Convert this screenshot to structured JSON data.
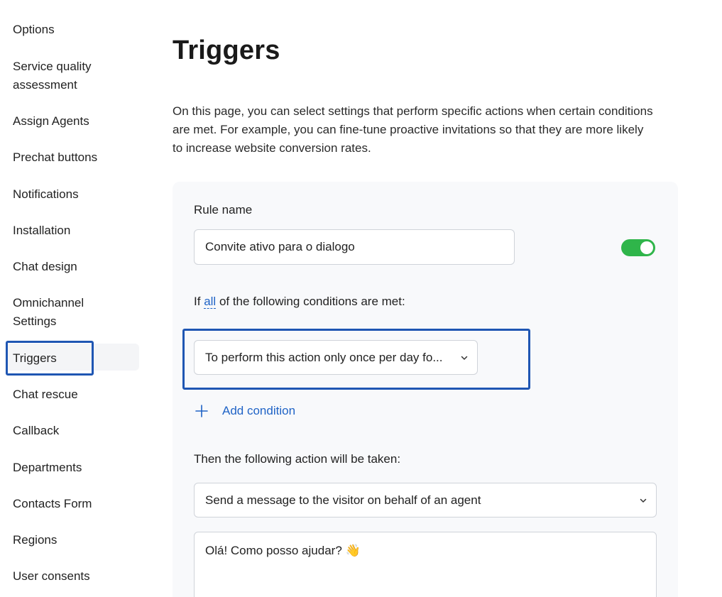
{
  "sidebar": {
    "items": [
      {
        "label": "Options"
      },
      {
        "label": "Service quality assessment"
      },
      {
        "label": "Assign Agents"
      },
      {
        "label": "Prechat buttons"
      },
      {
        "label": "Notifications"
      },
      {
        "label": "Installation"
      },
      {
        "label": "Chat design"
      },
      {
        "label": "Omnichannel Settings"
      },
      {
        "label": "Triggers"
      },
      {
        "label": "Chat rescue"
      },
      {
        "label": "Callback"
      },
      {
        "label": "Departments"
      },
      {
        "label": "Contacts Form"
      },
      {
        "label": "Regions"
      },
      {
        "label": "User consents"
      }
    ]
  },
  "page": {
    "title": "Triggers",
    "description": "On this page, you can select settings that perform specific actions when certain conditions are met. For example, you can fine-tune proactive invitations so that they are more likely to increase website conversion rates."
  },
  "rule": {
    "name_label": "Rule name",
    "name_value": "Convite ativo para o dialogo",
    "enabled": true,
    "conditions_prefix": "If",
    "conditions_link": "all",
    "conditions_suffix": "of the following conditions are met:",
    "condition_value": "To perform this action only once per day fo...",
    "add_condition_label": "Add condition",
    "action_label": "Then the following action will be taken:",
    "action_value": "Send a message to the visitor on behalf of an agent",
    "message_value": "Olá! Como posso ajudar? 👋"
  },
  "colors": {
    "accent": "#1f63c6",
    "highlight_border": "#1f56b3",
    "toggle_on": "#2fb54a"
  }
}
